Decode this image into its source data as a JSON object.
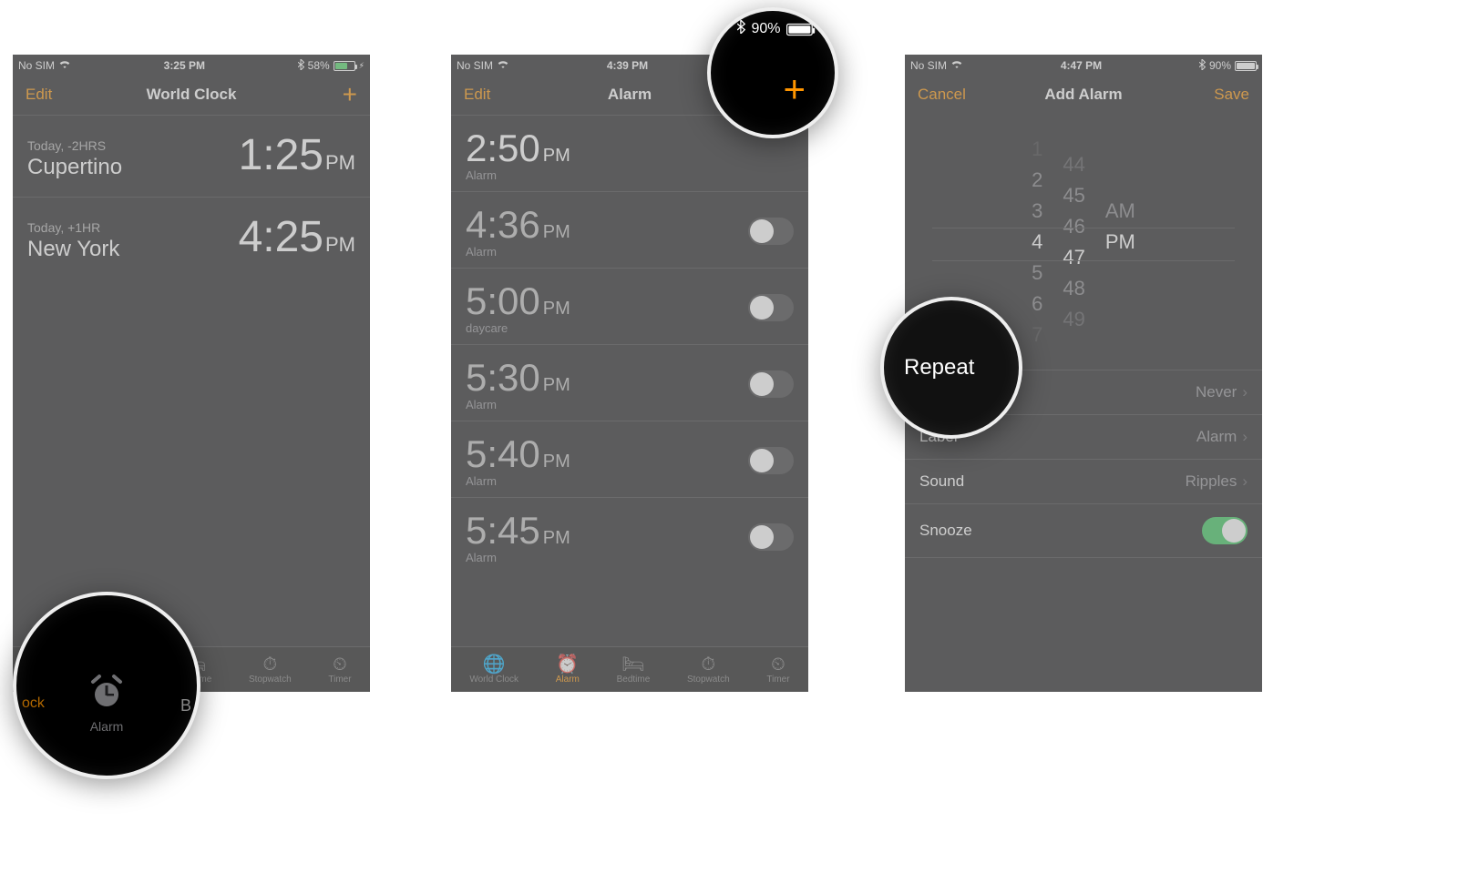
{
  "screens": {
    "world_clock": {
      "status": {
        "carrier": "No SIM",
        "time": "3:25 PM",
        "battery_pct": "58%",
        "charging": true
      },
      "nav": {
        "left": "Edit",
        "title": "World Clock",
        "right_icon": "+"
      },
      "rows": [
        {
          "offset": "Today, -2HRS",
          "city": "Cupertino",
          "time": "1:25",
          "ampm": "PM"
        },
        {
          "offset": "Today, +1HR",
          "city": "New York",
          "time": "4:25",
          "ampm": "PM"
        }
      ],
      "tabs": [
        "World Clock",
        "Alarm",
        "Bedtime",
        "Stopwatch",
        "Timer"
      ]
    },
    "alarm_list": {
      "status": {
        "carrier": "No SIM",
        "time": "4:39 PM",
        "battery_pct": "90%",
        "charging": false
      },
      "nav": {
        "left": "Edit",
        "title": "Alarm",
        "right_icon": "+"
      },
      "alarms": [
        {
          "time": "2:50",
          "ampm": "PM",
          "label": "Alarm",
          "on": null
        },
        {
          "time": "4:36",
          "ampm": "PM",
          "label": "Alarm",
          "on": false
        },
        {
          "time": "5:00",
          "ampm": "PM",
          "label": "daycare",
          "on": false
        },
        {
          "time": "5:30",
          "ampm": "PM",
          "label": "Alarm",
          "on": false
        },
        {
          "time": "5:40",
          "ampm": "PM",
          "label": "Alarm",
          "on": false
        },
        {
          "time": "5:45",
          "ampm": "PM",
          "label": "Alarm",
          "on": false
        }
      ],
      "tabs": [
        "World Clock",
        "Alarm",
        "Bedtime",
        "Stopwatch",
        "Timer"
      ],
      "active_tab": "Alarm"
    },
    "add_alarm": {
      "status": {
        "carrier": "No SIM",
        "time": "4:47 PM",
        "battery_pct": "90%",
        "charging": false
      },
      "nav": {
        "left": "Cancel",
        "title": "Add Alarm",
        "right": "Save"
      },
      "picker": {
        "hours": [
          "1",
          "2",
          "3",
          "4",
          "5",
          "6",
          "7"
        ],
        "minutes": [
          "44",
          "45",
          "46",
          "47",
          "48",
          "49"
        ],
        "ampm": [
          "AM",
          "PM"
        ],
        "selected": {
          "hour": "4",
          "minute": "47",
          "ampm": "PM"
        }
      },
      "settings": [
        {
          "key": "Repeat",
          "value": "Never",
          "chevron": true
        },
        {
          "key": "Label",
          "value": "Alarm",
          "chevron": true
        },
        {
          "key": "Sound",
          "value": "Ripples",
          "chevron": true
        },
        {
          "key": "Snooze",
          "value": "",
          "toggle_on": true
        }
      ]
    }
  },
  "magnifiers": {
    "alarm_tab": {
      "left_edge": "ock",
      "center": "Alarm",
      "right_edge": "B"
    },
    "plus": {
      "battery_pct": "90%",
      "plus": "+"
    },
    "repeat": {
      "label": "Repeat",
      "edge": ""
    }
  },
  "icons": {
    "wifi": "wifi",
    "bluetooth": "bluetooth",
    "plus": "plus",
    "world": "globe",
    "alarm": "alarm-clock",
    "bed": "bed",
    "stopwatch": "stopwatch",
    "timer": "timer"
  }
}
